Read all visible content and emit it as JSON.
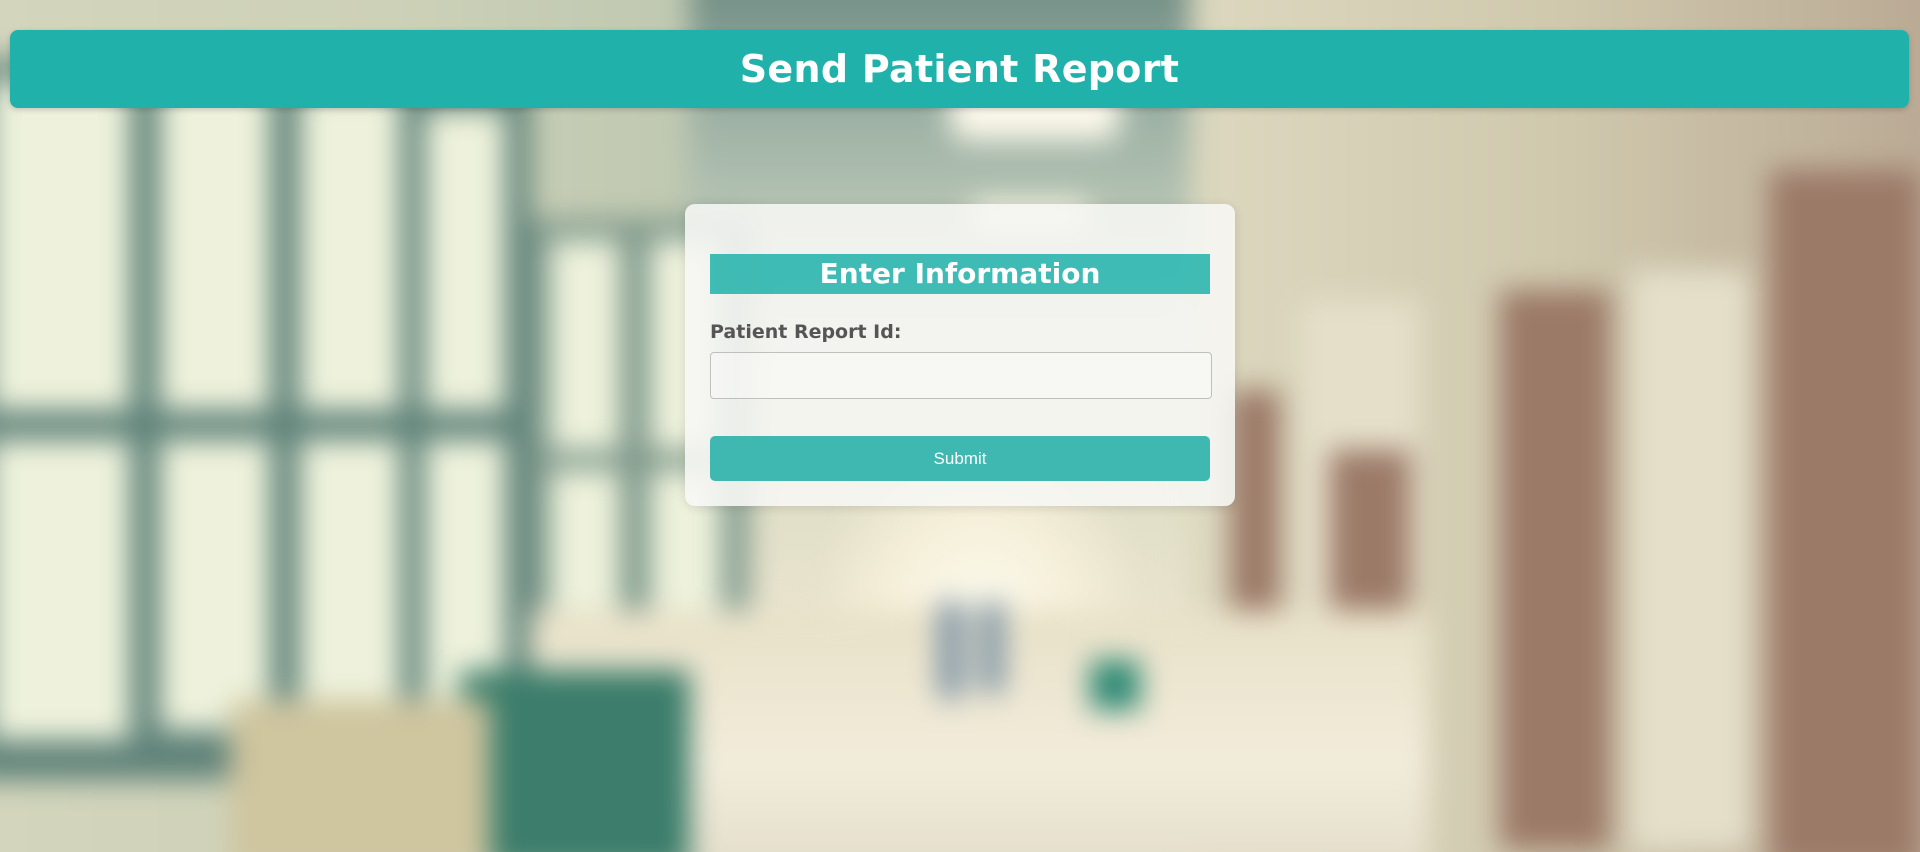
{
  "header": {
    "title": "Send Patient Report"
  },
  "form": {
    "title": "Enter Information",
    "report_id_label": "Patient Report Id:",
    "report_id_value": "",
    "submit_label": "Submit"
  },
  "theme": {
    "accent": "#20b2aa",
    "button": "#3fb8b1",
    "label_text": "#555555"
  }
}
